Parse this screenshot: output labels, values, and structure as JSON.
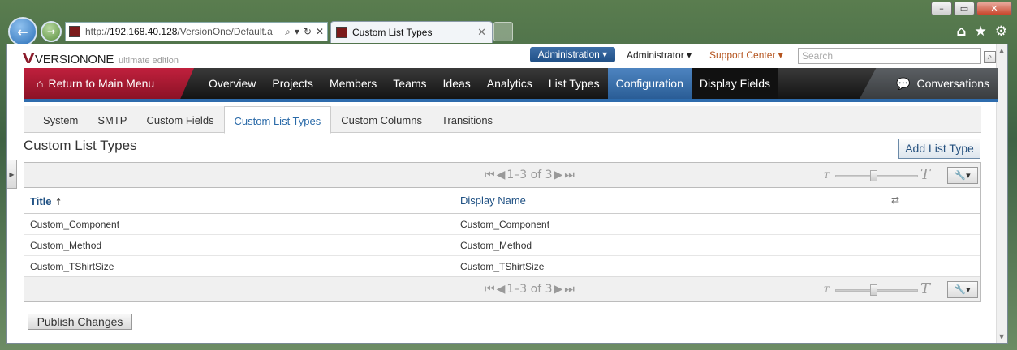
{
  "browser": {
    "url_prefix": "http://",
    "url_host": "192.168.40.128",
    "url_path": "/VersionOne/Default.a",
    "tab_title": "Custom List Types",
    "tab_close": "✕",
    "window_buttons": [
      "–",
      "▭",
      "✕"
    ]
  },
  "app": {
    "logo_name": "VERSIONONE",
    "logo_edition": "ultimate edition",
    "admin_button": "Administration ▾",
    "admin_user": "Administrator ▾",
    "support": "Support Center ▾",
    "search_placeholder": "Search"
  },
  "mainnav": {
    "return_label": "Return to Main Menu",
    "items": [
      "Overview",
      "Projects",
      "Members",
      "Teams",
      "Ideas",
      "Analytics",
      "List Types",
      "Configuration",
      "Display Fields"
    ],
    "conversations": "Conversations"
  },
  "subnav": {
    "tabs": [
      "System",
      "SMTP",
      "Custom Fields",
      "Custom List Types",
      "Custom Columns",
      "Transitions"
    ]
  },
  "page": {
    "title": "Custom List Types",
    "add_button": "Add List Type",
    "publish_button": "Publish Changes"
  },
  "grid": {
    "pager_text": "1–3 of 3",
    "columns": [
      "Title",
      "Display Name"
    ],
    "sort_indicator": "↑",
    "rows": [
      {
        "title": "Custom_Component",
        "display": "Custom_Component"
      },
      {
        "title": "Custom_Method",
        "display": "Custom_Method"
      },
      {
        "title": "Custom_TShirtSize",
        "display": "Custom_TShirtSize"
      }
    ]
  },
  "colors": {
    "accent": "#2e6cad",
    "brand": "#8b1b2b",
    "return": "#c0203d"
  }
}
